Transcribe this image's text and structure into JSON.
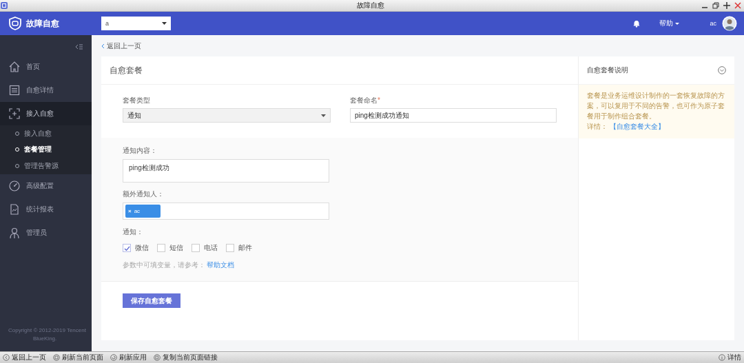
{
  "window": {
    "title": "故障自愈"
  },
  "header": {
    "logo_text": "故障自愈",
    "business_select": {
      "value": "a"
    },
    "help": "帮助",
    "user": "ac"
  },
  "sidebar": {
    "items": [
      {
        "label": "首页",
        "selected": false,
        "expanded": false
      },
      {
        "label": "自愈详情",
        "selected": false,
        "expanded": false
      },
      {
        "label": "接入自愈",
        "selected": false,
        "expanded": true,
        "children": [
          {
            "label": "接入自愈",
            "selected": false
          },
          {
            "label": "套餐管理",
            "selected": true
          },
          {
            "label": "管理告警源",
            "selected": false
          }
        ]
      },
      {
        "label": "高级配置",
        "selected": false,
        "expanded": false
      },
      {
        "label": "统计报表",
        "selected": false,
        "expanded": false
      },
      {
        "label": "管理员",
        "selected": false,
        "expanded": false
      }
    ],
    "copyright": [
      "Copyright © 2012-2019 Tencent",
      "BlueKing."
    ]
  },
  "back_link": "返回上一页",
  "form": {
    "title": "自愈套餐",
    "package_type": {
      "label": "套餐类型",
      "value": "通知"
    },
    "package_name": {
      "label": "套餐命名",
      "required_mark": "*",
      "value": "ping检测成功通知"
    },
    "content": {
      "label": "通知内容：",
      "value": "ping检测成功"
    },
    "extra_recipients": {
      "label": "额外通知人：",
      "tags": [
        {
          "remove": "×",
          "text": "ac"
        }
      ]
    },
    "notify": {
      "label": "通知：",
      "options": [
        {
          "label": "微信",
          "checked": true
        },
        {
          "label": "短信",
          "checked": false
        },
        {
          "label": "电话",
          "checked": false
        },
        {
          "label": "邮件",
          "checked": false
        }
      ]
    },
    "hint": {
      "text": "参数中可填变量，请参考：",
      "link": "帮助文档"
    },
    "save_button": "保存自愈套餐"
  },
  "info_panel": {
    "title": "自愈套餐说明",
    "text": "套餐是业务运维设计制作的一套恢复故障的方案，可以复用于不同的告警，也可作为原子套餐用于制作组合套餐。",
    "detail_label": "详情：",
    "link": "【自愈套餐大全】"
  },
  "status_bar": {
    "buttons": [
      "返回上一页",
      "刷新当前页面",
      "刷新应用",
      "复制当前页面链接"
    ],
    "details": "详情"
  }
}
